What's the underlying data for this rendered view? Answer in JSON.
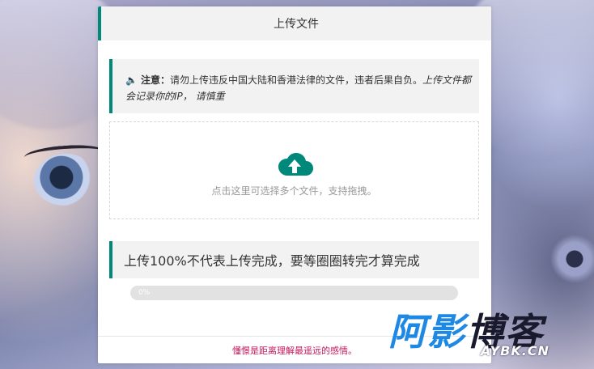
{
  "header": {
    "title": "上传文件"
  },
  "notice": {
    "icon": "speaker-icon",
    "label": "注意：",
    "text": "请勿上传违反中国大陆和香港法律的文件，违者后果自负。",
    "emphasis": "上传文件都会记录你的IP，  请慎重"
  },
  "dropzone": {
    "icon": "cloud-upload-icon",
    "hint": "点击这里可选择多个文件，支持拖拽。"
  },
  "status": {
    "text": "上传100%不代表上传完成，要等圈圈转完才算完成"
  },
  "progress": {
    "value": 0,
    "label": "0%"
  },
  "footer": {
    "text": "懂憬是距离理解最遥远的感情。"
  },
  "watermark": {
    "title": "阿影博客",
    "sub": "AYBK.CN"
  },
  "colors": {
    "accent": "#00897b",
    "footer_text": "#c2185b",
    "panel_bg": "#f2f2f2"
  }
}
